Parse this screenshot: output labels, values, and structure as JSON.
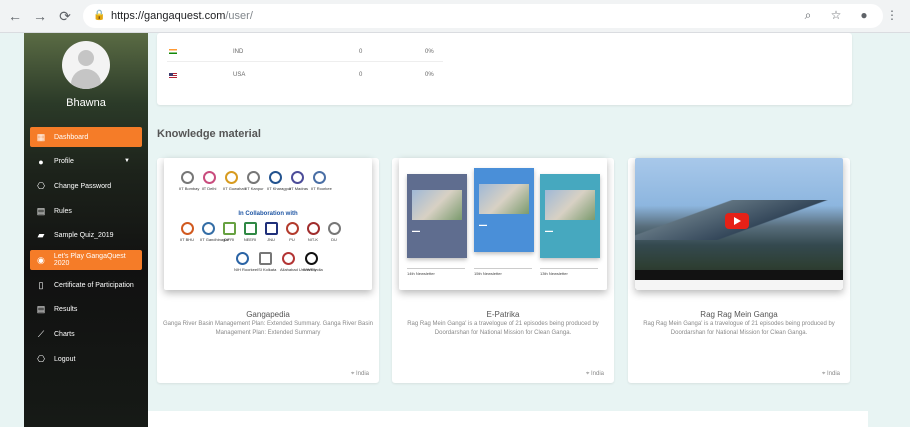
{
  "browser": {
    "url_host": "https://gangaquest.com",
    "url_path": "/user/"
  },
  "sidebar": {
    "user_name": "Bhawna",
    "items": [
      {
        "label": "Dashboard",
        "icon": "dashboard-icon",
        "active": true
      },
      {
        "label": "Profile",
        "icon": "person-icon"
      },
      {
        "label": "Change Password",
        "icon": "lock-icon"
      },
      {
        "label": "Rules",
        "icon": "rules-icon"
      },
      {
        "label": "Sample Quiz_2019",
        "icon": "quiz-icon"
      },
      {
        "label": "Let's Play GangaQuest 2020",
        "icon": "play-icon",
        "active": true
      },
      {
        "label": "Certificate of Participation",
        "icon": "certificate-icon"
      },
      {
        "label": "Results",
        "icon": "results-icon"
      },
      {
        "label": "Charts",
        "icon": "chart-icon"
      },
      {
        "label": "Logout",
        "icon": "logout-icon"
      }
    ]
  },
  "countries": [
    {
      "code": "IND",
      "count": "0",
      "pct": "0%"
    },
    {
      "code": "USA",
      "count": "0",
      "pct": "0%"
    }
  ],
  "knowledge": {
    "title": "Knowledge material",
    "cards": [
      {
        "title": "Gangapedia",
        "desc": "Ganga River Basin Management Plan: Extended Summary. Ganga River Basin Management Plan: Extended Summary",
        "location": "India"
      },
      {
        "title": "E-Patrika",
        "desc": "Rag Rag Mein Ganga' is a travelogue of 21 episodes being produced by Doordarshan for National Mission for Clean Ganga.",
        "location": "India"
      },
      {
        "title": "Rag Rag Mein Ganga",
        "desc": "Rag Rag Mein Ganga' is a travelogue of 21 episodes being produced by Doordarshan for National Mission for Clean Ganga.",
        "location": "India"
      }
    ]
  },
  "gangapedia_logos": {
    "row1": [
      "IIT Bombay",
      "IIT Delhi",
      "IIT Guwahati",
      "IIT Kanpur",
      "IIT Kharagpur",
      "IIT Madras",
      "IIT Roorkee"
    ],
    "collab": "In Collaboration with",
    "row2": [
      "IIT BHU",
      "IIT Gandhinagar",
      "CIFRI",
      "NEERI",
      "JNU",
      "PU",
      "NIT-K",
      "DU"
    ],
    "row3": [
      "NIH Roorkee",
      "ISI Kolkata",
      "Allahabad University",
      "WWF India"
    ]
  },
  "epatrika": {
    "newsletters": [
      "14th Newsletter",
      "15th Newsletter",
      "13th Newsletter"
    ]
  }
}
